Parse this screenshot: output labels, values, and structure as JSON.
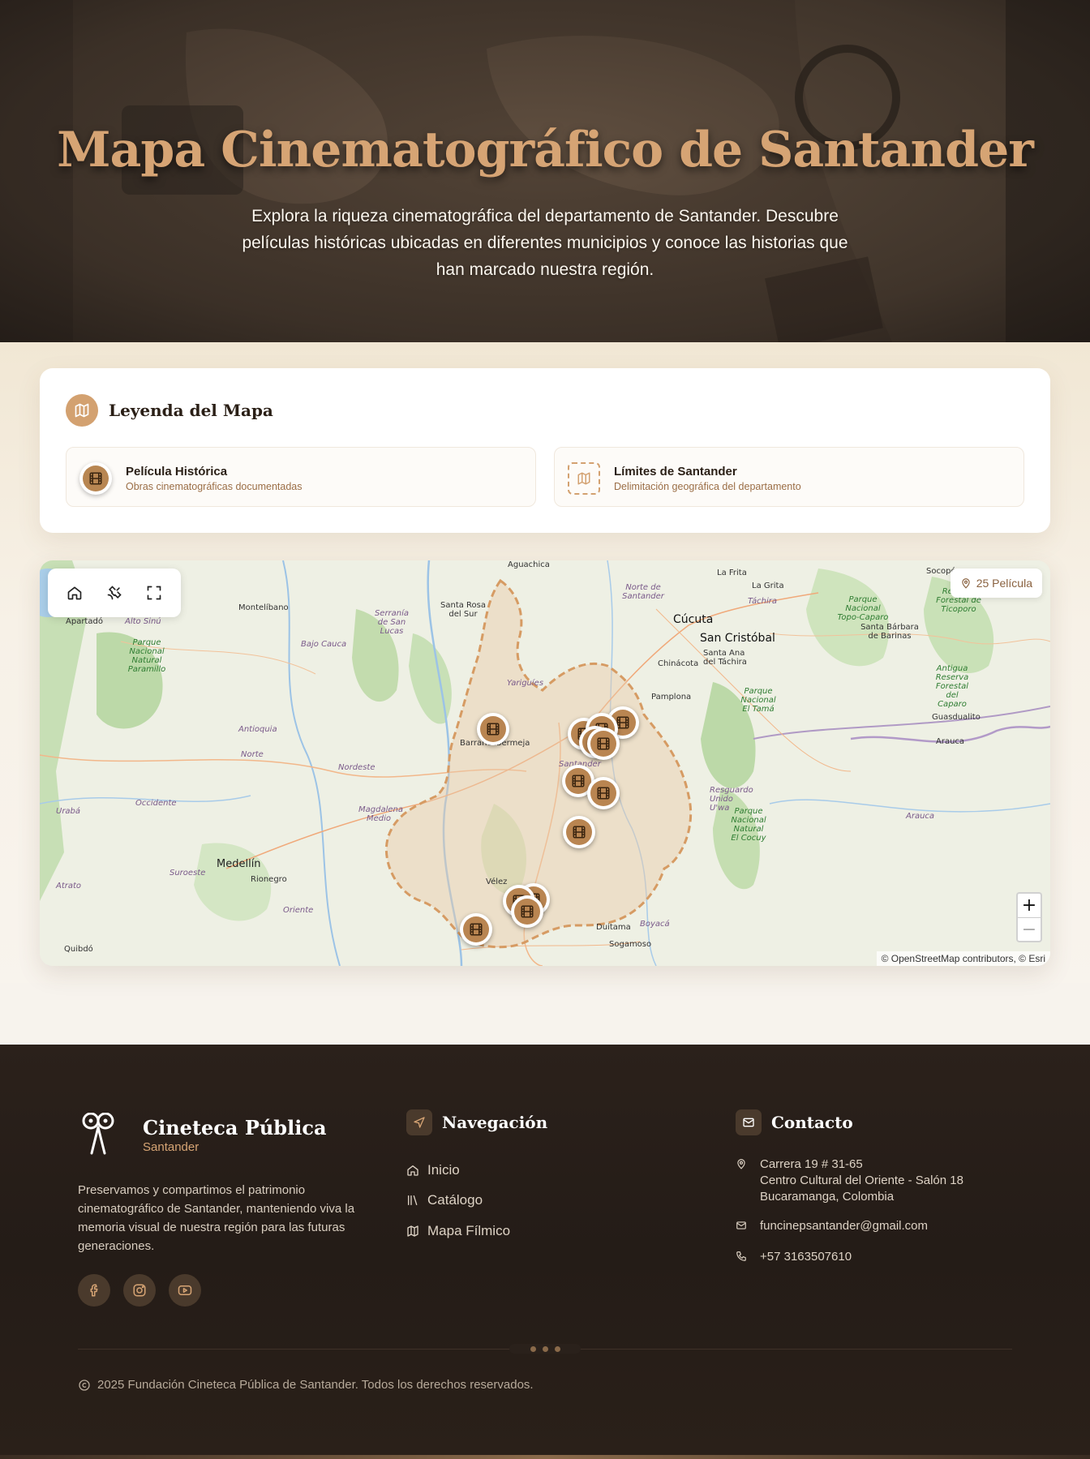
{
  "hero": {
    "title": "Mapa Cinematográfico de Santander",
    "subtitle": "Explora la riqueza cinematográfica del departamento de Santander. Descubre películas históricas ubicadas en diferentes municipios y conoce las historias que han marcado nuestra región."
  },
  "legend": {
    "title": "Leyenda del Mapa",
    "items": [
      {
        "title": "Película Histórica",
        "desc": "Obras cinematográficas documentadas",
        "icon": "film-icon"
      },
      {
        "title": "Límites de Santander",
        "desc": "Delimitación geográfica del departamento",
        "icon": "map-icon"
      }
    ]
  },
  "map": {
    "count_label": "25 Película",
    "zoom_in": "+",
    "zoom_out": "−",
    "attribution": "© OpenStreetMap contributors, © Esri",
    "toolbar": [
      "home-icon",
      "satellite-icon",
      "fullscreen-icon"
    ],
    "labels": {
      "aguachica": "Aguachica",
      "montelibano": "Montelíbano",
      "apartado": "Apartadó",
      "alto_sinu": "Alto Sinú",
      "parque_paramillo": "Parque Nacional Natural Paramillo",
      "serrania_lucas": "Serranía de San Lucas",
      "bajo_cauca": "Bajo Cauca",
      "santa_rosa": "Santa Rosa del Sur",
      "norte_santander": "Norte de Santander",
      "la_frontera": "La Frita",
      "la_grita": "La Grita",
      "tachira": "Táchira",
      "socopo": "Socopó",
      "cucuta": "Cúcuta",
      "san_cristobal": "San Cristóbal",
      "santa_ana": "Santa Ana del Táchira",
      "chinacota": "Chinácota",
      "pamplona": "Pamplona",
      "parque_tama": "Parque Nacional El Tamá",
      "santa_barbara": "Santa Bárbara de Barinas",
      "parque_tapo": "Parque Nacional Topo-Caparo",
      "reserva_ticoporo": "Reserva Forestal de Ticoporo",
      "antigua_caparo": "Antigua Reserva Forestal del Caparo",
      "guasdualito": "Guasdualito",
      "arauca_city": "Arauca",
      "arauca_region": "Arauca",
      "yariguies": "Yariguíes",
      "barrancabermeja": "Barrancabermeja",
      "antioquia": "Antioquia",
      "norte": "Norte",
      "nordeste": "Nordeste",
      "occidente": "Occidente",
      "uraba": "Urabá",
      "magdalena_medio": "Magdalena Medio",
      "santander": "Santander",
      "resguardo": "Resguardo Unido U'wa",
      "parque_cocuy": "Parque Nacional Natural El Cocuy",
      "medellin": "Medellín",
      "rionegro": "Rionegro",
      "suroeste": "Suroeste",
      "oriente": "Oriente",
      "atrato": "Atrato",
      "velez": "Vélez",
      "duitama": "Duitama",
      "boyaca": "Boyacá",
      "sogamoso": "Sogamoso",
      "quibdo": "Quibdó"
    }
  },
  "footer": {
    "brand_name": "Cineteca Pública",
    "brand_sub": "Santander",
    "description": "Preservamos y compartimos el patrimonio cinematográfico de Santander, manteniendo viva la memoria visual de nuestra región para las futuras generaciones.",
    "socials": [
      "facebook-icon",
      "instagram-icon",
      "youtube-icon"
    ],
    "nav_title": "Navegación",
    "nav_items": [
      {
        "label": "Inicio",
        "icon": "home-icon"
      },
      {
        "label": "Catálogo",
        "icon": "library-icon"
      },
      {
        "label": "Mapa Fílmico",
        "icon": "map-icon"
      }
    ],
    "contact_title": "Contacto",
    "address_lines": [
      "Carrera 19 # 31-65",
      "Centro Cultural del Oriente - Salón 18",
      "Bucaramanga, Colombia"
    ],
    "email": "funcinepsantander@gmail.com",
    "phone": "+57 3163507610",
    "copyright": "2025 Fundación Cineteca Pública de Santander. Todos los derechos reservados."
  },
  "colors": {
    "accent": "#d3a170",
    "marker": "#b98551",
    "footer_bg": "#241c17"
  }
}
